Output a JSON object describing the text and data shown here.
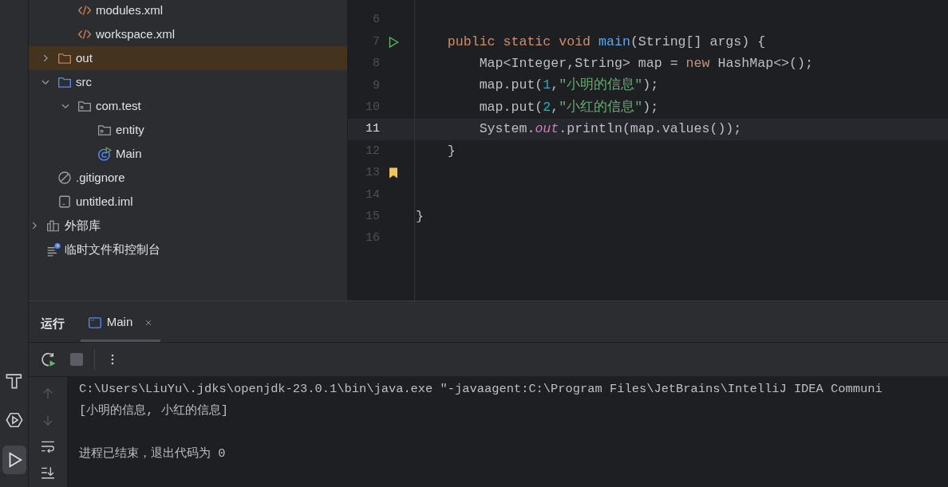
{
  "project_tree": [
    {
      "children": [
        {
          "children": [
            {
              "label": "modules.xml",
              "kind": "xml",
              "selected": false
            },
            {
              "label": "workspace.xml",
              "kind": "xml",
              "selected": false
            }
          ]
        },
        {
          "label": "out",
          "kind": "excluded-folder",
          "expanded": false,
          "selected": true
        },
        {
          "label": "src",
          "kind": "source-folder",
          "expanded": true,
          "selected": false,
          "children": [
            {
              "label": "com.test",
              "kind": "package",
              "expanded": true,
              "selected": false,
              "children": [
                {
                  "label": "entity",
                  "kind": "package",
                  "selected": false
                },
                {
                  "label": "Main",
                  "kind": "class",
                  "selected": false
                }
              ]
            }
          ]
        },
        {
          "label": ".gitignore",
          "kind": "ignore",
          "selected": false
        },
        {
          "label": "untitled.iml",
          "kind": "iml",
          "selected": false
        }
      ]
    },
    {
      "label": "外部库",
      "kind": "library",
      "expanded": false,
      "selected": false
    },
    {
      "label": "临时文件和控制台",
      "kind": "scratch",
      "selected": false
    }
  ],
  "editor": {
    "lines": [
      {
        "number": "6",
        "run_marker": false,
        "bookmarked": false,
        "current": false
      },
      {
        "number": "7",
        "run_marker": true,
        "bookmarked": false,
        "current": false,
        "tokens": [
          {
            "text": "    public static void ",
            "kind": "keyword"
          },
          {
            "text": "main",
            "kind": "method"
          },
          {
            "text": "(String[] args) {"
          }
        ]
      },
      {
        "number": "8",
        "run_marker": false,
        "bookmarked": false,
        "current": false,
        "tokens": [
          {
            "text": "        Map<Integer,String> map = "
          },
          {
            "text": "new ",
            "kind": "keyword"
          },
          {
            "text": "HashMap<>();"
          }
        ]
      },
      {
        "number": "9",
        "run_marker": false,
        "bookmarked": false,
        "current": false,
        "tokens": [
          {
            "text": "        map.put("
          },
          {
            "text": "1",
            "kind": "number"
          },
          {
            "text": ","
          },
          {
            "text": "\"小明的信息\"",
            "kind": "string"
          },
          {
            "text": ");"
          }
        ]
      },
      {
        "number": "10",
        "run_marker": false,
        "bookmarked": false,
        "current": false,
        "tokens": [
          {
            "text": "        map.put("
          },
          {
            "text": "2",
            "kind": "number"
          },
          {
            "text": ","
          },
          {
            "text": "\"小红的信息\"",
            "kind": "string"
          },
          {
            "text": ");"
          }
        ]
      },
      {
        "number": "11",
        "run_marker": false,
        "bookmarked": false,
        "current": true,
        "tokens": [
          {
            "text": "        System."
          },
          {
            "text": "out",
            "kind": "static-field"
          },
          {
            "text": ".println(map.values());"
          }
        ]
      },
      {
        "number": "12",
        "run_marker": false,
        "bookmarked": false,
        "current": false,
        "tokens": [
          {
            "text": "    }"
          }
        ]
      },
      {
        "number": "13",
        "run_marker": false,
        "bookmarked": true,
        "current": false
      },
      {
        "number": "14",
        "run_marker": false,
        "bookmarked": false,
        "current": false
      },
      {
        "number": "15",
        "run_marker": false,
        "bookmarked": false,
        "current": false,
        "tokens": [
          {
            "text": "}"
          }
        ]
      },
      {
        "number": "16",
        "run_marker": false,
        "bookmarked": false,
        "current": false
      }
    ]
  },
  "run_panel": {
    "title": "运行",
    "tabs": [
      {
        "label": "Main",
        "selected": true
      }
    ],
    "console": [
      {
        "text": "C:\\Users\\LiuYu\\.jdks\\openjdk-23.0.1\\bin\\java.exe \"-javaagent:C:\\Program Files\\JetBrains\\IntelliJ IDEA Communi",
        "blank_line_before": false
      },
      {
        "text": "[小明的信息, 小红的信息]",
        "blank_line_before": false
      },
      {
        "text": "进程已结束，退出代码为 0",
        "blank_line_before": true
      }
    ]
  },
  "tool_strip": [
    {
      "kind": "build",
      "selected": false
    },
    {
      "kind": "services",
      "selected": false
    },
    {
      "kind": "run",
      "selected": true
    }
  ]
}
